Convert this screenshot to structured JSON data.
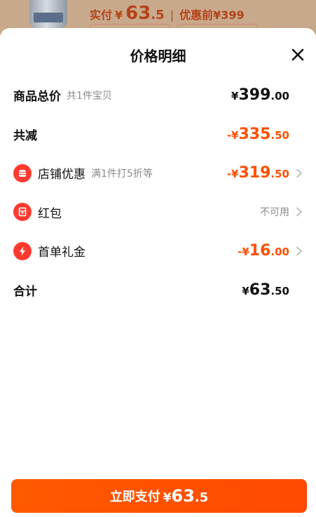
{
  "background": {
    "price_label": "实付",
    "currency": "¥",
    "price_int": "63",
    "price_dec": ".5",
    "separator": "|",
    "original_label": "优惠前",
    "original_price": "¥399"
  },
  "sheet": {
    "title": "价格明细"
  },
  "rows": {
    "total": {
      "label": "商品总价",
      "sub": "共1件宝贝",
      "yen": "¥",
      "int": "399",
      "dec": ".00"
    },
    "reduced": {
      "label": "共减",
      "yen": "-¥",
      "int": "335",
      "dec": ".50"
    },
    "store_discount": {
      "label": "店铺优惠",
      "sub": "满1件打5折等",
      "yen": "-¥",
      "int": "319",
      "dec": ".50",
      "icon": "store-icon"
    },
    "red_packet": {
      "label": "红包",
      "value": "不可用",
      "icon": "red-packet-icon"
    },
    "first_order": {
      "label": "首单礼金",
      "yen": "-¥",
      "int": "16",
      "dec": ".00",
      "icon": "lightning-icon"
    },
    "sum": {
      "label": "合计",
      "yen": "¥",
      "int": "63",
      "dec": ".50"
    }
  },
  "pay": {
    "label": "立即支付",
    "yen": "¥",
    "int": "63",
    "dec": ".5"
  },
  "colors": {
    "accent": "#ff5000",
    "icon_red": "#ff3b30"
  }
}
